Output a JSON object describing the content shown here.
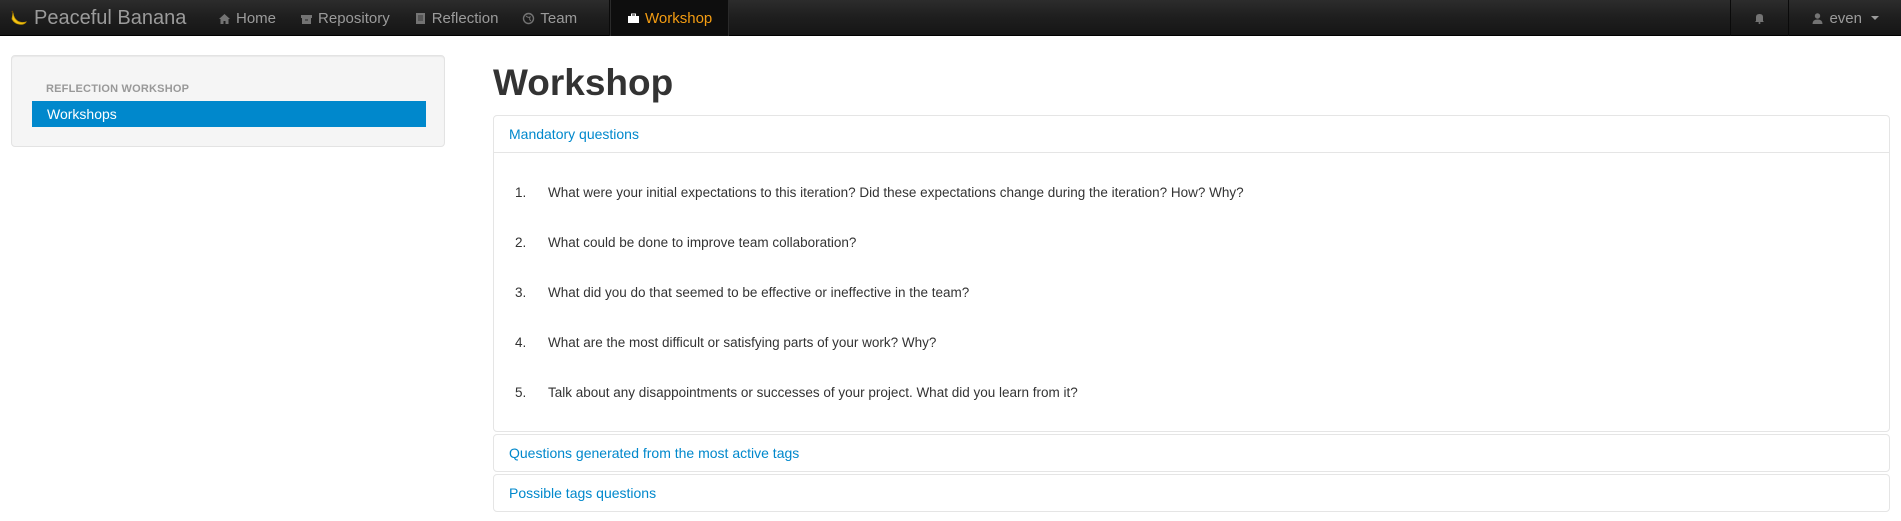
{
  "navbar": {
    "brand": "Peaceful Banana",
    "items": [
      {
        "label": "Home",
        "icon": "home-icon"
      },
      {
        "label": "Repository",
        "icon": "archive-icon"
      },
      {
        "label": "Reflection",
        "icon": "book-icon"
      },
      {
        "label": "Team",
        "icon": "globe-icon"
      }
    ],
    "active_item": {
      "label": "Workshop",
      "icon": "briefcase-icon"
    },
    "notifications_icon": "bell-icon",
    "user": {
      "label": "even",
      "icon": "user-icon"
    },
    "active_color": "#f39c12"
  },
  "sidebar": {
    "header": "REFLECTION WORKSHOP",
    "items": [
      {
        "label": "Workshops",
        "active": true
      }
    ],
    "active_color": "#0088cc"
  },
  "main": {
    "title": "Workshop",
    "panels": [
      {
        "heading": "Mandatory questions",
        "expanded": true,
        "questions": [
          {
            "num": "1.",
            "text": "What were your initial expectations to this iteration? Did these expectations change during the iteration? How? Why?"
          },
          {
            "num": "2.",
            "text": "What could be done to improve team collaboration?"
          },
          {
            "num": "3.",
            "text": "What did you do that seemed to be effective or ineffective in the team?"
          },
          {
            "num": "4.",
            "text": "What are the most difficult or satisfying parts of your work? Why?"
          },
          {
            "num": "5.",
            "text": "Talk about any disappointments or successes of your project. What did you learn from it?"
          }
        ]
      },
      {
        "heading": "Questions generated from the most active tags",
        "expanded": false
      },
      {
        "heading": "Possible tags questions",
        "expanded": false
      }
    ]
  }
}
